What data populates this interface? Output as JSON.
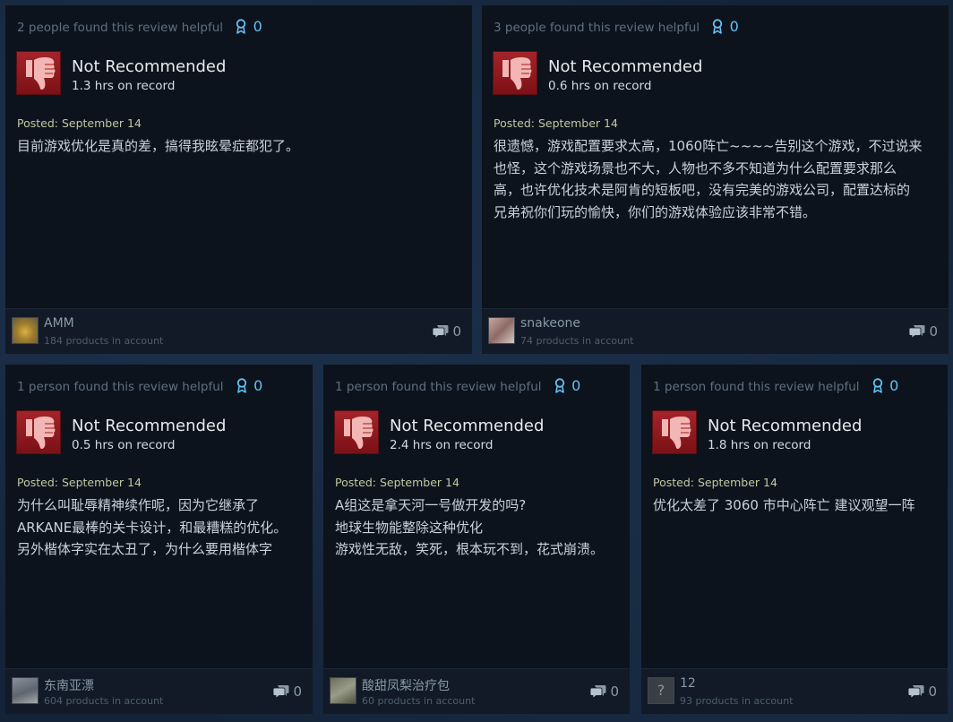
{
  "reviews": [
    {
      "helpful": "2 people found this review helpful",
      "awards": "0",
      "verdict": "Not Recommended",
      "hours": "1.3 hrs on record",
      "posted": "Posted: September 14",
      "lines": [
        "目前游戏优化是真的差，搞得我眩晕症都犯了。"
      ],
      "user": "AMM",
      "products": "184 products in account",
      "comments": "0",
      "icons": {
        "thumb": "thumbs-down-icon",
        "award": "award-ribbon-icon",
        "comment": "comment-bubble-icon"
      }
    },
    {
      "helpful": "3 people found this review helpful",
      "awards": "0",
      "verdict": "Not Recommended",
      "hours": "0.6 hrs on record",
      "posted": "Posted: September 14",
      "lines": [
        "很遗憾，游戏配置要求太高，1060阵亡~~~~告别这个游戏，不过说来",
        "也怪，这个游戏场景也不大，人物也不多不知道为什么配置要求那么",
        "高，也许优化技术是阿肯的短板吧，没有完美的游戏公司，配置达标的",
        "兄弟祝你们玩的愉快，你们的游戏体验应该非常不错。"
      ],
      "user": "snakeone",
      "products": "74 products in account",
      "comments": "0"
    },
    {
      "helpful": "1 person found this review helpful",
      "awards": "0",
      "verdict": "Not Recommended",
      "hours": "0.5 hrs on record",
      "posted": "Posted: September 14",
      "lines": [
        "为什么叫耻辱精神续作呢，因为它继承了",
        "ARKANE最棒的关卡设计，和最糟糕的优化。",
        "另外楷体字实在太丑了，为什么要用楷体字"
      ],
      "user": "东南亚漂",
      "products": "604 products in account",
      "comments": "0"
    },
    {
      "helpful": "1 person found this review helpful",
      "awards": "0",
      "verdict": "Not Recommended",
      "hours": "2.4 hrs on record",
      "posted": "Posted: September 14",
      "lines": [
        "A组这是拿天河一号做开发的吗?",
        "地球生物能整除这种优化",
        "游戏性无敌，笑死，根本玩不到，花式崩溃。"
      ],
      "user": "酸甜凤梨治疗包",
      "products": "60 products in account",
      "comments": "0"
    },
    {
      "helpful": "1 person found this review helpful",
      "awards": "0",
      "verdict": "Not Recommended",
      "hours": "1.8 hrs on record",
      "posted": "Posted: September 14",
      "lines": [
        "优化太差了 3060 市中心阵亡 建议观望一阵"
      ],
      "user": "12",
      "products": "93 products in account",
      "comments": "0",
      "avatar_glyph": "?"
    }
  ],
  "colors": {
    "accent": "#66c0f4",
    "thumb_red": "#a3242a",
    "posted": "#c1c9a2"
  }
}
